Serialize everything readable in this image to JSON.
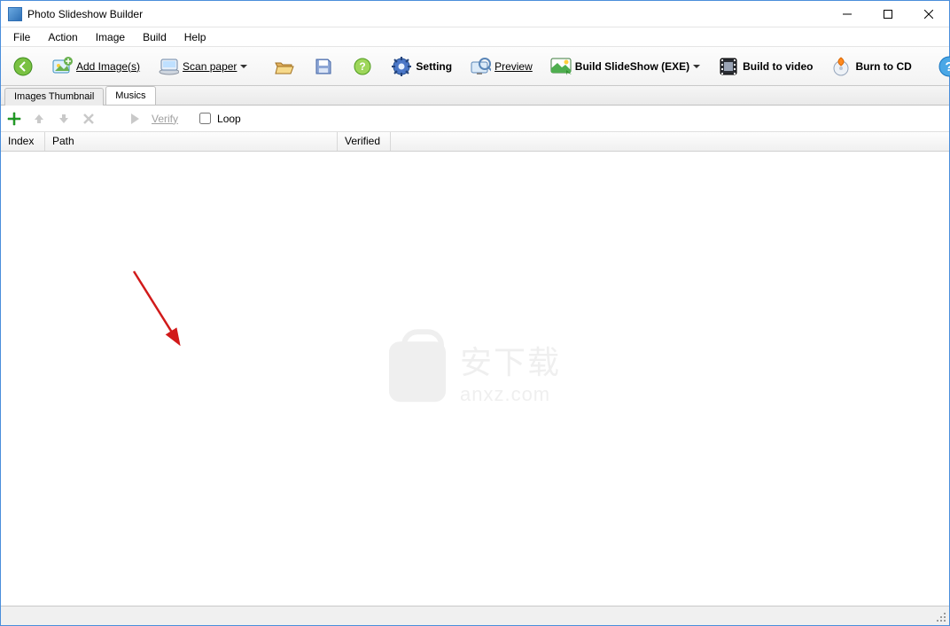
{
  "window": {
    "title": "Photo Slideshow Builder"
  },
  "menu": {
    "items": [
      "File",
      "Action",
      "Image",
      "Build",
      "Help"
    ]
  },
  "toolbar": {
    "add_images": "Add Image(s)",
    "scan_paper": "Scan paper",
    "setting": "Setting",
    "preview": "Preview",
    "build_slideshow": "Build SlideShow (EXE)",
    "build_to_video": "Build to video",
    "burn_to_cd": "Burn to CD"
  },
  "tabs": {
    "thumbnail": "Images Thumbnail",
    "musics": "Musics",
    "active": "musics"
  },
  "subtoolbar": {
    "verify": "Verify",
    "loop": "Loop",
    "loop_checked": false
  },
  "columns": {
    "index": "Index",
    "path": "Path",
    "verified": "Verified"
  },
  "watermark": {
    "line1": "安下载",
    "line2": "anxz.com"
  }
}
